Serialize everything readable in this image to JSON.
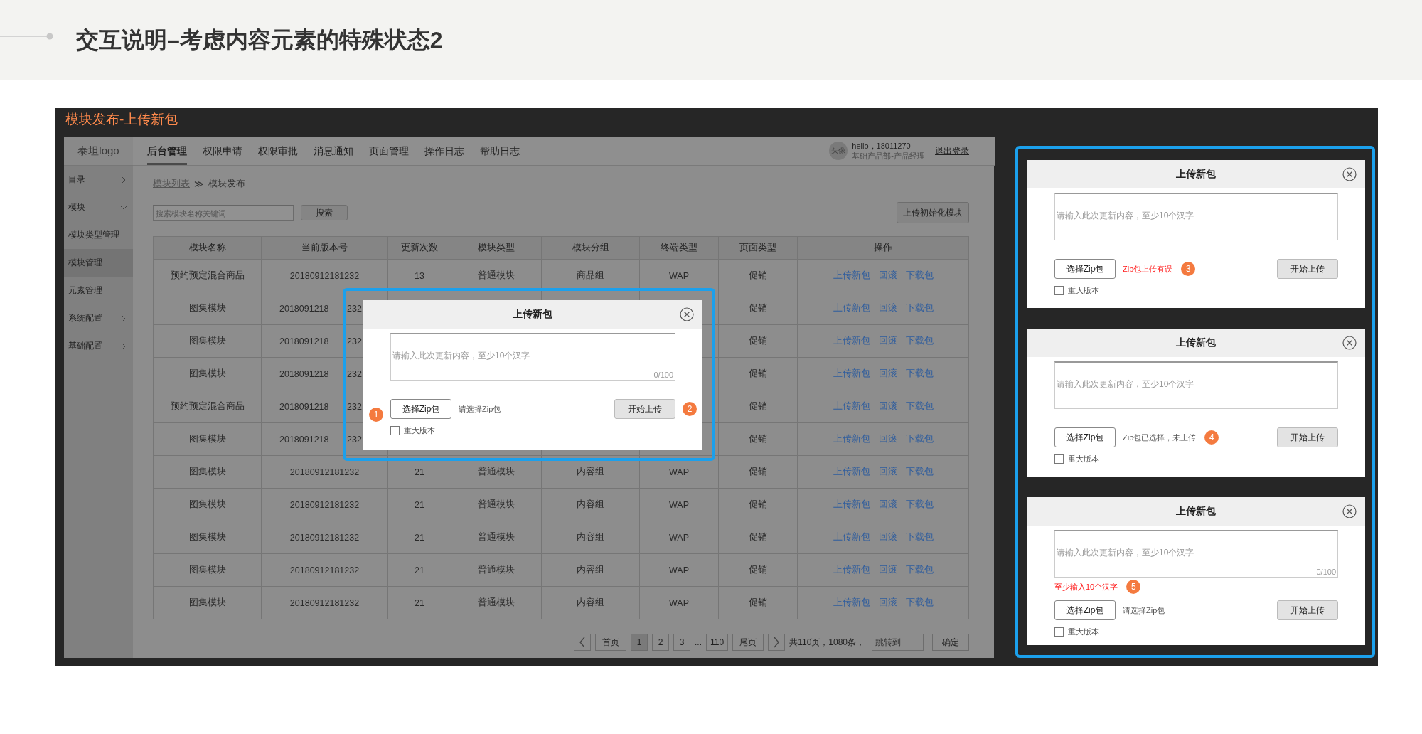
{
  "page_title": "交互说明–考虑内容元素的特殊状态2",
  "frame_title": "模块发布-上传新包",
  "mockup": {
    "logo": "泰坦logo",
    "nav_tabs": [
      {
        "label": "后台管理",
        "selected": true
      },
      {
        "label": "权限申请",
        "selected": false
      },
      {
        "label": "权限审批",
        "selected": false
      },
      {
        "label": "消息通知",
        "selected": false
      },
      {
        "label": "页面管理",
        "selected": false
      },
      {
        "label": "操作日志",
        "selected": false
      },
      {
        "label": "帮助日志",
        "selected": false
      }
    ],
    "user": {
      "avatar": "头像",
      "greeting": "hello，18011270",
      "role": "基础产品部-产品经理",
      "logout": "退出登录"
    },
    "sidebar": [
      {
        "label": "目录",
        "expanded": false,
        "selected": false
      },
      {
        "label": "模块",
        "expanded": true,
        "selected": false
      },
      {
        "label": "模块类型管理",
        "selected": false
      },
      {
        "label": "模块管理",
        "selected": true
      },
      {
        "label": "元素管理",
        "selected": false
      },
      {
        "label": "系统配置",
        "expanded": false,
        "selected": false
      },
      {
        "label": "基础配置",
        "expanded": false,
        "selected": false
      }
    ],
    "breadcrumb": {
      "link": "模块列表",
      "separator": "≫",
      "current": "模块发布"
    },
    "search": {
      "placeholder": "搜索模块名称关键词",
      "button": "搜索"
    },
    "init_button": "上传初始化模块",
    "table": {
      "columns": [
        "模块名称",
        "当前版本号",
        "更新次数",
        "模块类型",
        "模块分组",
        "终端类型",
        "页面类型",
        "操作"
      ],
      "rows": [
        {
          "name": "预约预定混合商品",
          "version": "20180912181232",
          "count": "13",
          "type": "普通模块",
          "group": "商品组",
          "terminal": "WAP",
          "page_type": "促销",
          "actions": [
            "上传新包",
            "回滚",
            "下载包"
          ]
        },
        {
          "name": "图集模块",
          "version": "2018091218",
          "version_tail": "232",
          "page_type": "促销",
          "actions": [
            "上传新包",
            "回滚",
            "下载包"
          ]
        },
        {
          "name": "图集模块",
          "version": "2018091218",
          "version_tail": "232",
          "page_type": "促销",
          "actions": [
            "上传新包",
            "回滚",
            "下载包"
          ]
        },
        {
          "name": "图集模块",
          "version": "2018091218",
          "version_tail": "232",
          "page_type": "促销",
          "actions": [
            "上传新包",
            "回滚",
            "下载包"
          ]
        },
        {
          "name": "预约预定混合商品",
          "version": "2018091218",
          "version_tail": "232",
          "page_type": "促销",
          "actions": [
            "上传新包",
            "回滚",
            "下载包"
          ]
        },
        {
          "name": "图集模块",
          "version": "2018091218",
          "version_tail": "232",
          "page_type": "促销",
          "actions": [
            "上传新包",
            "回滚",
            "下载包"
          ]
        },
        {
          "name": "图集模块",
          "version": "20180912181232",
          "count": "21",
          "type": "普通模块",
          "group": "内容组",
          "terminal": "WAP",
          "page_type": "促销",
          "actions": [
            "上传新包",
            "回滚",
            "下载包"
          ]
        },
        {
          "name": "图集模块",
          "version": "20180912181232",
          "count": "21",
          "type": "普通模块",
          "group": "内容组",
          "terminal": "WAP",
          "page_type": "促销",
          "actions": [
            "上传新包",
            "回滚",
            "下载包"
          ]
        },
        {
          "name": "图集模块",
          "version": "20180912181232",
          "count": "21",
          "type": "普通模块",
          "group": "内容组",
          "terminal": "WAP",
          "page_type": "促销",
          "actions": [
            "上传新包",
            "回滚",
            "下载包"
          ]
        },
        {
          "name": "图集模块",
          "version": "20180912181232",
          "count": "21",
          "type": "普通模块",
          "group": "内容组",
          "terminal": "WAP",
          "page_type": "促销",
          "actions": [
            "上传新包",
            "回滚",
            "下载包"
          ]
        },
        {
          "name": "图集模块",
          "version": "20180912181232",
          "count": "21",
          "type": "普通模块",
          "group": "内容组",
          "terminal": "WAP",
          "page_type": "促销",
          "actions": [
            "上传新包",
            "回滚",
            "下载包"
          ]
        }
      ]
    },
    "pagination": {
      "first": "首页",
      "pages": [
        {
          "kind": "page",
          "label": "1",
          "selected": true
        },
        {
          "kind": "page",
          "label": "2",
          "selected": false
        },
        {
          "kind": "page",
          "label": "3",
          "selected": false
        },
        {
          "kind": "ellipsis",
          "label": "..."
        },
        {
          "kind": "page",
          "label": "110",
          "selected": false
        }
      ],
      "last": "尾页",
      "summary": "共110页，1080条，",
      "jump_label": "跳转到",
      "confirm": "确定"
    },
    "dialog": {
      "title": "上传新包",
      "placeholder": "请输入此次更新内容，至少10个汉字",
      "counter": "0/100",
      "select_button": "选择Zip包",
      "status": {
        "text": "请选择Zip包",
        "kind": "normal"
      },
      "upload_button": "开始上传",
      "checkbox": {
        "label": "重大版本",
        "checked": false
      },
      "annotations": [
        {
          "number": "1",
          "kind": "select"
        },
        {
          "number": "2",
          "kind": "upload"
        }
      ]
    }
  },
  "state_dialogs": [
    {
      "title": "上传新包",
      "placeholder": "请输入此次更新内容，至少10个汉字",
      "select_button": "选择Zip包",
      "status": {
        "text": "Zip包上传有误",
        "kind": "error"
      },
      "upload_button": "开始上传",
      "checkbox": {
        "label": "重大版本",
        "checked": false
      },
      "annotations": [
        {
          "number": "3",
          "kind": "status"
        }
      ]
    },
    {
      "title": "上传新包",
      "placeholder": "请输入此次更新内容，至少10个汉字",
      "select_button": "选择Zip包",
      "status": {
        "text": "Zip包已选择，未上传",
        "kind": "normal"
      },
      "upload_button": "开始上传",
      "checkbox": {
        "label": "重大版本",
        "checked": false
      },
      "annotations": [
        {
          "number": "4",
          "kind": "status"
        }
      ]
    },
    {
      "title": "上传新包",
      "placeholder": "请输入此次更新内容，至少10个汉字",
      "counter": "0/100",
      "error": "至少输入10个汉字",
      "select_button": "选择Zip包",
      "status": {
        "text": "请选择Zip包",
        "kind": "normal"
      },
      "upload_button": "开始上传",
      "checkbox": {
        "label": "重大版本",
        "checked": false
      },
      "annotations": [
        {
          "number": "5",
          "kind": "error"
        }
      ]
    }
  ]
}
